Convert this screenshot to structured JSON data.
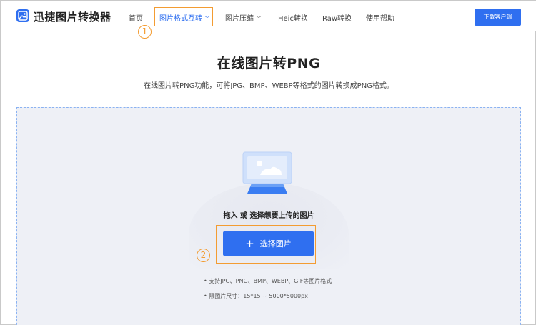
{
  "app": {
    "brand": "迅捷图片转换器"
  },
  "nav": {
    "home": "首页",
    "format": "图片格式互转",
    "compress": "图片压缩",
    "heic": "Heic转换",
    "raw": "Raw转换",
    "help": "使用帮助",
    "download": "下载客户端"
  },
  "annotations": {
    "step1": "1",
    "step2": "2"
  },
  "main": {
    "title": "在线图片转PNG",
    "subtitle": "在线图片转PNG功能，可将JPG、BMP、WEBP等格式的图片转换成PNG格式。",
    "drag_text": "拖入 或 选择想要上传的图片",
    "select_button": "选择图片",
    "hint_formats": "• 支持JPG、PNG、BMP、WEBP、GIF等图片格式",
    "hint_size": "• 限图片尺寸：15*15 ~ 5000*5000px"
  },
  "colors": {
    "accent": "#2f6ff0",
    "highlight": "#f39c32",
    "drop_bg": "#eef0f6"
  }
}
